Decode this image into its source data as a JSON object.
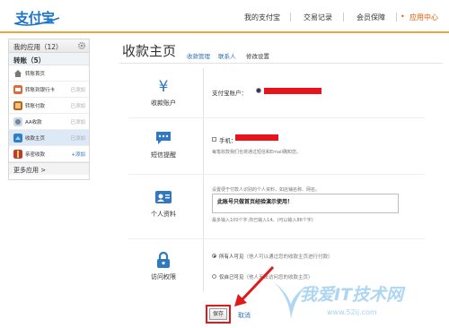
{
  "header": {
    "logo_text": "支付宝",
    "nav": [
      "我的支付宝",
      "交易记录",
      "会员保障",
      "应用中心"
    ],
    "accent_color": "#f1a33a"
  },
  "sidebar": {
    "title": "我的应用（12）",
    "group_title": "转账（5）",
    "items": [
      {
        "label": "转账首页",
        "extra": "",
        "icon": "home-icon"
      },
      {
        "label": "转账到银行卡",
        "extra": "已添加",
        "icon": "bank-card-icon"
      },
      {
        "label": "转账付款",
        "extra": "已添加",
        "icon": "transfer-icon"
      },
      {
        "label": "AA收款",
        "extra": "已添加",
        "icon": "aa-icon"
      },
      {
        "label": "收款主页",
        "extra": "已添加",
        "icon": "homepage-icon"
      },
      {
        "label": "亲密收款",
        "extra": "+添加",
        "icon": "gift-icon"
      }
    ],
    "more_label": "更多应用 >"
  },
  "main": {
    "title": "收款主页",
    "tabs": [
      "收款管理",
      "联系人",
      "修改设置"
    ],
    "sections": {
      "account": {
        "label": "收款账户",
        "field_label": "支付宝账户："
      },
      "sms": {
        "label": "短信提醒",
        "field_label": "手机：",
        "hint": "每笔收款我们也将通过短信和Email确知您。"
      },
      "profile": {
        "label": "个人资料",
        "hint_top": "设置便于付款人识别的个人资料，如店铺名称、网名。",
        "textarea_value": "此账号只做首页经验演示使用！",
        "hint_bottom": "最多输入100个字,你已输入14。(可以输入86个字)"
      },
      "access": {
        "label": "访问权限",
        "option_all": "所有人可见",
        "option_all_note": "（他人可以通过您的收款主页进行付款）",
        "option_self": "仅自己可见",
        "option_self_note": "（他人无法访问您的收款主页）"
      }
    },
    "save_label": "保存",
    "cancel_label": "取消"
  },
  "watermark": {
    "main": "我爱IT技术网",
    "sub": "www.52ij.com"
  }
}
